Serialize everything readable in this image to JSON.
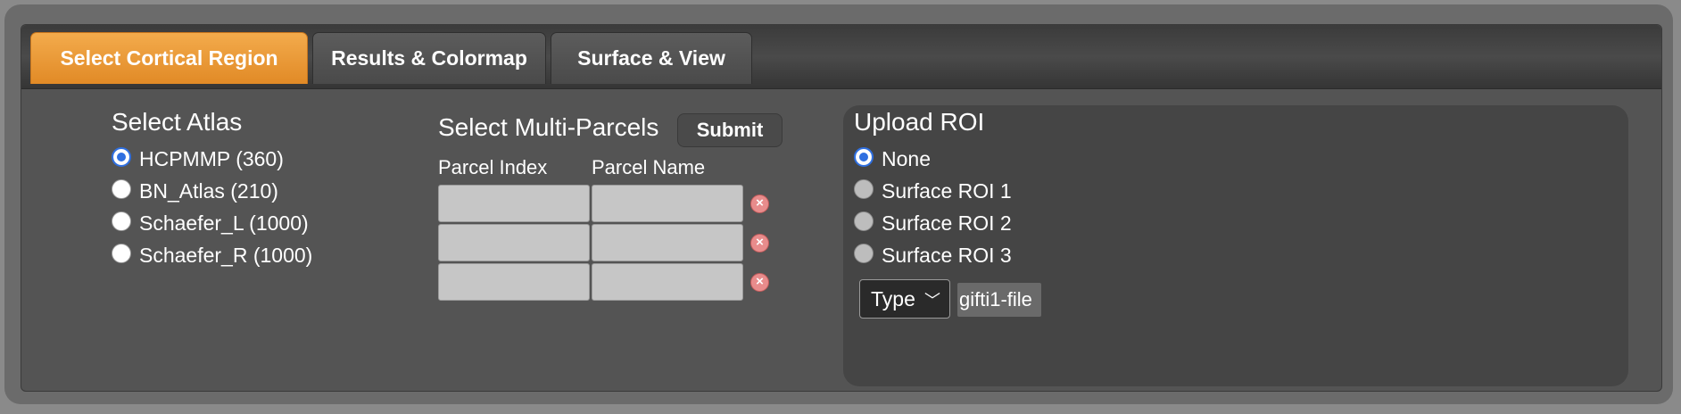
{
  "tabs": [
    {
      "label": "Select Cortical Region"
    },
    {
      "label": "Results & Colormap"
    },
    {
      "label": "Surface & View"
    }
  ],
  "atlas": {
    "heading": "Select Atlas",
    "options": [
      {
        "label": "HCPMMP (360)",
        "selected": true
      },
      {
        "label": "BN_Atlas (210)",
        "selected": false
      },
      {
        "label": "Schaefer_L (1000)",
        "selected": false
      },
      {
        "label": "Schaefer_R (1000)",
        "selected": false
      }
    ]
  },
  "parcels": {
    "heading": "Select Multi-Parcels",
    "submit_label": "Submit",
    "col_index": "Parcel Index",
    "col_name": "Parcel Name",
    "rows": [
      {
        "index": "",
        "name": ""
      },
      {
        "index": "",
        "name": ""
      },
      {
        "index": "",
        "name": ""
      }
    ],
    "delete_icon": "×"
  },
  "roi": {
    "heading": "Upload ROI",
    "options": [
      {
        "label": "None",
        "selected": true
      },
      {
        "label": "Surface ROI 1",
        "selected": false
      },
      {
        "label": "Surface ROI 2",
        "selected": false
      },
      {
        "label": "Surface ROI 3",
        "selected": false
      }
    ],
    "type_label": "Type",
    "chevron": "﹀",
    "file_label": "gifti1-file"
  }
}
